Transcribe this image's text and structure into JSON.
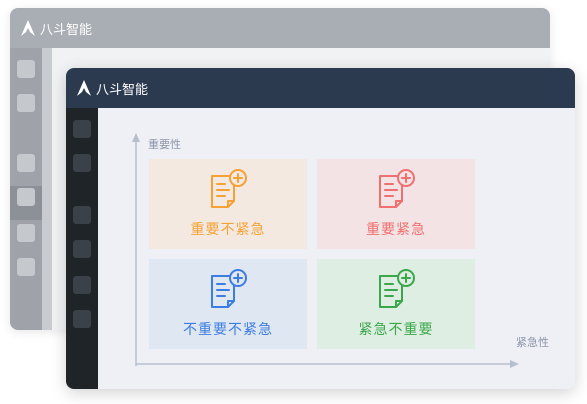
{
  "app": {
    "brand_name": "八斗智能"
  },
  "matrix": {
    "y_axis_label": "重要性",
    "x_axis_label": "紧急性",
    "quadrants": [
      {
        "label": "重要不紧急",
        "color": "#f5a135",
        "bg": "#f4e9e1"
      },
      {
        "label": "重要紧急",
        "color": "#f06f6f",
        "bg": "#f3e3e4"
      },
      {
        "label": "不重要不紧急",
        "color": "#3d7de0",
        "bg": "#dfe7f3"
      },
      {
        "label": "紧急不重要",
        "color": "#3aa84a",
        "bg": "#deeee2"
      }
    ]
  },
  "icons": {
    "brand": "logo-icon",
    "quadrant": "note-add-icon"
  },
  "colors": {
    "front_header": "#2c3a50",
    "front_sidebar": "#1f2428",
    "back_header": "#a9adb4"
  }
}
